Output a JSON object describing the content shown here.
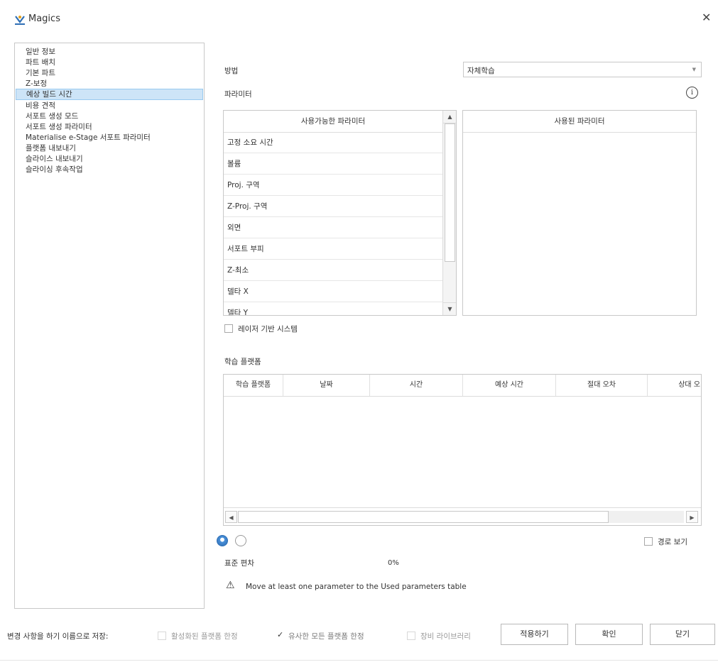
{
  "window": {
    "title": "Magics",
    "close_glyph": "✕"
  },
  "nav": {
    "items": [
      {
        "label": "일반 정보",
        "selected": false
      },
      {
        "label": "파트 배치",
        "selected": false
      },
      {
        "label": "기본 파트",
        "selected": false
      },
      {
        "label": "Z-보정",
        "selected": false
      },
      {
        "label": "예상 빌드 시간",
        "selected": true
      },
      {
        "label": "비용 견적",
        "selected": false
      },
      {
        "label": "서포트 생성 모드",
        "selected": false
      },
      {
        "label": "서포트 생성 파라미터",
        "selected": false
      },
      {
        "label": "Materialise e-Stage 서포트 파라미터",
        "selected": false
      },
      {
        "label": "플랫폼 내보내기",
        "selected": false
      },
      {
        "label": "슬라이스 내보내기",
        "selected": false
      },
      {
        "label": "슬라이싱 후속작업",
        "selected": false
      }
    ]
  },
  "method": {
    "label": "방법",
    "value": "자체학습"
  },
  "parameters": {
    "label": "파라미터",
    "info_glyph": "i",
    "available_header": "사용가능한 파라미터",
    "used_header": "사용된 파라미터",
    "available": [
      "고정 소요 시간",
      "볼륨",
      "Proj. 구역",
      "Z-Proj. 구역",
      "외면",
      "서포트 부피",
      "Z-최소",
      "델타 X",
      "델타 Y"
    ],
    "scroll_up": "▲",
    "scroll_down": "▼"
  },
  "laser": {
    "label": "레이저 기반 시스템",
    "checked": false
  },
  "learning": {
    "label": "학습 플랫폼",
    "columns": [
      "학습 플랫폼",
      "날짜",
      "시간",
      "예상 시간",
      "절대 오차",
      "상대 오"
    ],
    "scroll_left": "◀",
    "scroll_right": "▶"
  },
  "path_view": {
    "label": "경로 보기",
    "checked": false
  },
  "std_dev": {
    "label": "표준 편차",
    "value": "0%"
  },
  "warning": {
    "icon": "⚠",
    "text": "Move at least one parameter to the Used parameters table"
  },
  "footer": {
    "save_label": "변경 사항을 하기 이름으로 저장:",
    "opt_active": "활성화된 플랫폼 한정",
    "opt_similar": "유사한 모든 플랫폼 한정",
    "opt_library": "장비 라이브러리",
    "check_glyph": "✓",
    "apply": "적용하기",
    "ok": "확인",
    "close": "닫기"
  },
  "colors": {
    "selection": "#cde4f7",
    "border": "#c8c8c8",
    "accent": "#2f6fb5"
  }
}
